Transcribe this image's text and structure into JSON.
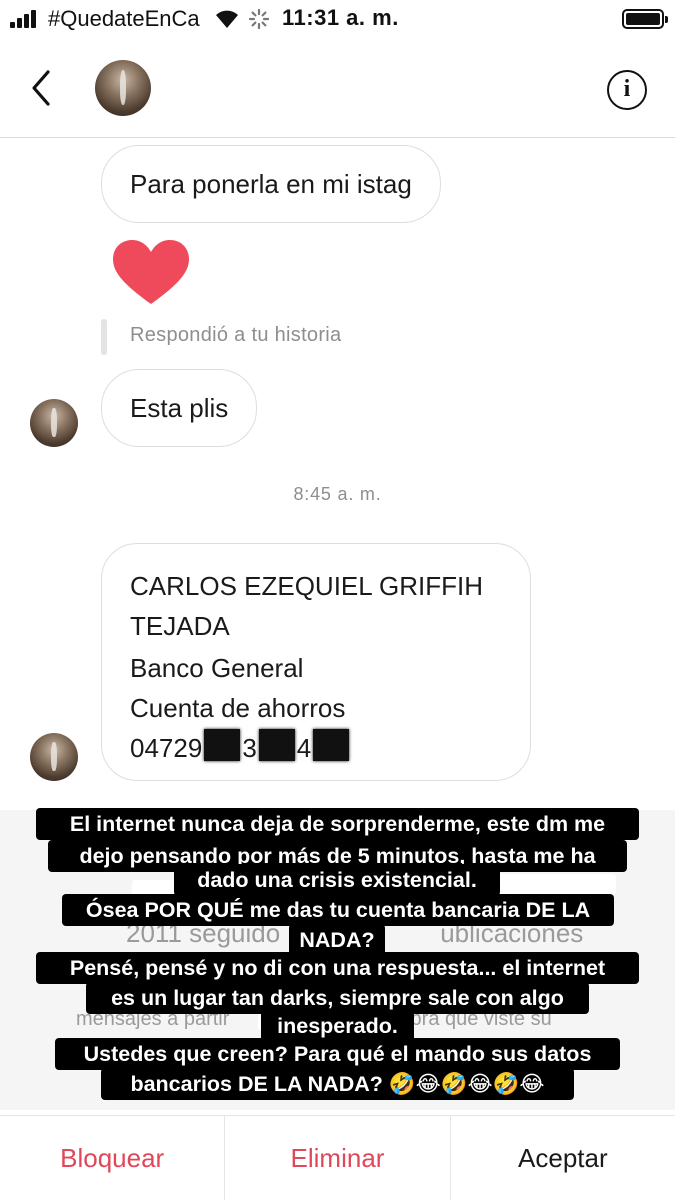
{
  "status_bar": {
    "carrier": "#QuedateEnCa",
    "time": "11:31 a. m."
  },
  "header": {
    "back_icon": "chevron-left-icon",
    "info_label": "i"
  },
  "messages": {
    "m1": "Para ponerla en mi istag",
    "reaction": "heart",
    "reply_note": "Respondió a tu historia",
    "m2": "Esta plis",
    "timestamp": "8:45 a. m.",
    "m3": {
      "line1": "CARLOS EZEQUIEL GRIFFIH",
      "line2": "TEJADA",
      "line3": "Banco General",
      "line4": "Cuenta de ahorros",
      "line5_prefix": "04729",
      "line5_mid": "3",
      "line5_mid2": "4"
    }
  },
  "background_text": {
    "g1": "mensaje",
    "g2": "2011 seguido",
    "g2b": "ublicaciones",
    "g3": "mensajes a partir",
    "g3b": "sabrá que viste su"
  },
  "caption": {
    "l1": "El internet nunca deja de sorprenderme, este dm me",
    "l2": "dejo pensando por más de 5 minutos, hasta me ha",
    "l3": "dado una crisis existencial.",
    "l4": "Ósea POR QUÉ me das tu cuenta bancaria DE LA",
    "l5": "NADA?",
    "l6": "Pensé, pensé y no di con una respuesta... el internet",
    "l7": "es un lugar tan darks, siempre sale con algo",
    "l8": "inesperado.",
    "l9": "Ustedes que creen? Para qué el mando sus datos",
    "l10": "bancarios DE LA NADA? 🤣😂🤣😂🤣😂"
  },
  "actions": {
    "block": "Bloquear",
    "delete": "Eliminar",
    "accept": "Aceptar"
  },
  "colors": {
    "danger": "#e0475b",
    "heart": "#ef4a5c"
  }
}
